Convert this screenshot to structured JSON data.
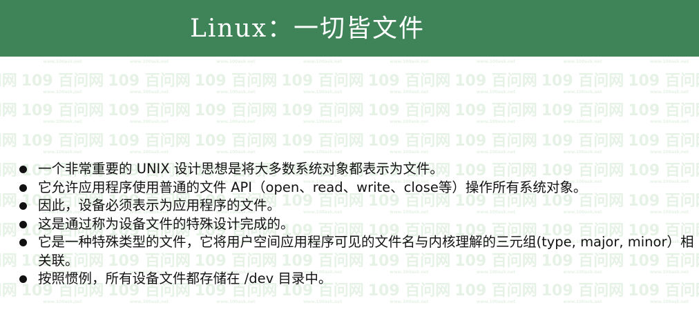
{
  "title": "Linux：一切皆文件",
  "watermark": {
    "logo": "109 百问网",
    "url": "www.100ask.net"
  },
  "bullets": [
    "一个非常重要的 UNIX 设计思想是将大多数系统对象都表示为文件。",
    "它允许应用程序使用普通的文件 API（open、read、write、close等）操作所有系统对象。",
    "因此，设备必须表示为应用程序的文件。",
    "这是通过称为设备文件的特殊设计完成的。",
    "它是一种特殊类型的文件，它将用户空间应用程序可见的文件名与内核理解的三元组(type, major, minor）相关联。",
    "按照惯例，所有设备文件都存储在 /dev 目录中。"
  ],
  "colors": {
    "header": "#3f8358",
    "watermark": "#e6f2e6"
  }
}
